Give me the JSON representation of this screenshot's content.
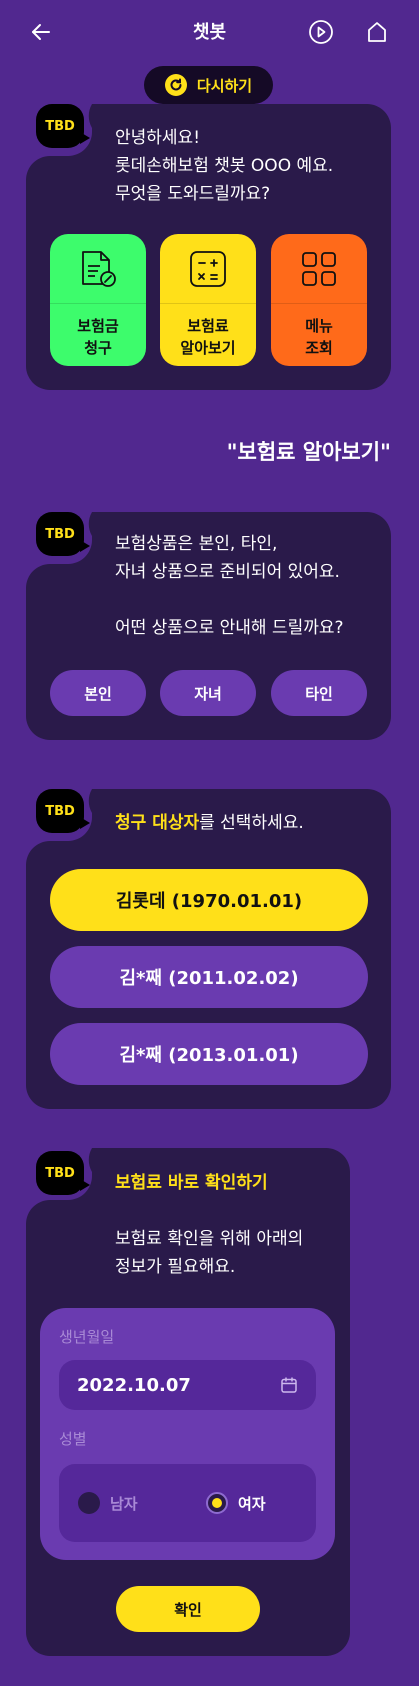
{
  "header": {
    "title": "챗봇",
    "back_icon": "arrow-left-icon",
    "play_icon": "play-circle-icon",
    "home_icon": "home-icon"
  },
  "retry": {
    "label": "다시하기",
    "icon": "refresh-icon"
  },
  "avatar_label": "TBD",
  "greeting": {
    "message": "안녕하세요!\n롯데손해보험 챗봇 OOO 예요.\n무엇을 도와드릴까요?",
    "tiles": [
      {
        "label": "보험금\n청구",
        "icon": "claim-document-icon",
        "color": "#3dfc6c"
      },
      {
        "label": "보험료\n알아보기",
        "icon": "calculator-icon",
        "color": "#ffe019"
      },
      {
        "label": "메뉴\n조회",
        "icon": "grid-menu-icon",
        "color": "#ff6a1a"
      }
    ]
  },
  "user_reply": "\"보험료 알아보기\"",
  "product_type": {
    "message": "보험상품은 본인, 타인,\n자녀 상품으로 준비되어 있어요.\n\n어떤 상품으로 안내해 드릴까요?",
    "options": [
      "본인",
      "자녀",
      "타인"
    ]
  },
  "target_select": {
    "highlight": "청구 대상자",
    "rest": "를 선택하세요.",
    "options": [
      {
        "label": "김롯데 (1970.01.01)",
        "selected": true
      },
      {
        "label": "김*째 (2011.02.02)",
        "selected": false
      },
      {
        "label": "김*째 (2013.01.01)",
        "selected": false
      }
    ]
  },
  "premium_check": {
    "title": "보험료 바로 확인하기",
    "message": "보험료 확인을 위해 아래의\n정보가 필요해요.",
    "birth_label": "생년월일",
    "birth_value": "2022.10.07",
    "calendar_icon": "calendar-icon",
    "gender_label": "성별",
    "gender_options": [
      {
        "label": "남자",
        "selected": false
      },
      {
        "label": "여자",
        "selected": true
      }
    ],
    "confirm_label": "확인"
  },
  "colors": {
    "background": "#51288f",
    "card": "#2a1a4a",
    "accent": "#ffe019",
    "pill": "#6a3bb0"
  }
}
